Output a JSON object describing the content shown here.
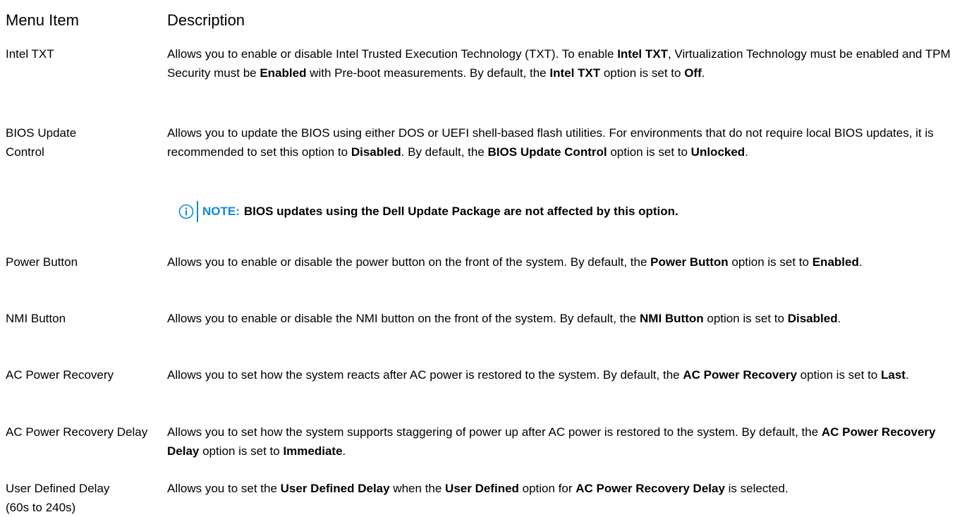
{
  "header": {
    "col1": "Menu Item",
    "col2": "Description"
  },
  "rows": [
    {
      "item": "Intel TXT",
      "desc": [
        {
          "t": "Allows you to enable or disable Intel Trusted Execution Technology (TXT). To enable "
        },
        {
          "t": "Intel TXT",
          "b": true
        },
        {
          "t": ", Virtualization Technology must be enabled and TPM Security must be "
        },
        {
          "t": "Enabled",
          "b": true
        },
        {
          "t": " with Pre-boot measurements. By default, the "
        },
        {
          "t": "Intel TXT",
          "b": true
        },
        {
          "t": " option is set to "
        },
        {
          "t": "Off",
          "b": true
        },
        {
          "t": "."
        }
      ]
    },
    {
      "item": "BIOS Update Control",
      "desc": [
        {
          "t": "Allows you to update the BIOS using either DOS or UEFI shell-based flash utilities. For environments that do not require local BIOS updates, it is recommended to set this option to "
        },
        {
          "t": "Disabled",
          "b": true
        },
        {
          "t": ". By default, the "
        },
        {
          "t": "BIOS Update Control",
          "b": true
        },
        {
          "t": " option is set to "
        },
        {
          "t": "Unlocked",
          "b": true
        },
        {
          "t": "."
        }
      ]
    },
    {
      "item": "Power Button",
      "desc": [
        {
          "t": "Allows you to enable or disable the power button on the front of the system. By default, the "
        },
        {
          "t": "Power Button",
          "b": true
        },
        {
          "t": " option is set to "
        },
        {
          "t": "Enabled",
          "b": true
        },
        {
          "t": "."
        }
      ]
    },
    {
      "item": "NMI Button",
      "desc": [
        {
          "t": "Allows you to enable or disable the NMI button on the front of the system. By default, the "
        },
        {
          "t": "NMI Button",
          "b": true
        },
        {
          "t": " option is set to "
        },
        {
          "t": "Disabled",
          "b": true
        },
        {
          "t": "."
        }
      ]
    },
    {
      "item": "AC Power Recovery",
      "desc": [
        {
          "t": "Allows you to set how the system reacts after AC power is restored to the system. By default, the "
        },
        {
          "t": "AC Power Recovery",
          "b": true
        },
        {
          "t": " option is set to "
        },
        {
          "t": "Last",
          "b": true
        },
        {
          "t": "."
        }
      ]
    },
    {
      "item": "AC Power Recovery Delay",
      "desc": [
        {
          "t": "Allows you to set how the system supports staggering of power up after AC power is restored to the system. By default, the "
        },
        {
          "t": "AC Power Recovery Delay",
          "b": true
        },
        {
          "t": " option is set to "
        },
        {
          "t": "Immediate",
          "b": true
        },
        {
          "t": "."
        }
      ]
    },
    {
      "item": "User Defined Delay (60s to 240s)",
      "desc": [
        {
          "t": "Allows you to set the "
        },
        {
          "t": "User Defined Delay",
          "b": true
        },
        {
          "t": " when the "
        },
        {
          "t": "User Defined",
          "b": true
        },
        {
          "t": " option for "
        },
        {
          "t": "AC Power Recovery Delay",
          "b": true
        },
        {
          "t": " is selected."
        }
      ]
    }
  ],
  "note": {
    "label": "NOTE:",
    "text": "BIOS updates using the Dell Update Package are not affected by this option.",
    "icon": "info-icon",
    "color": "#0f8cd0"
  }
}
